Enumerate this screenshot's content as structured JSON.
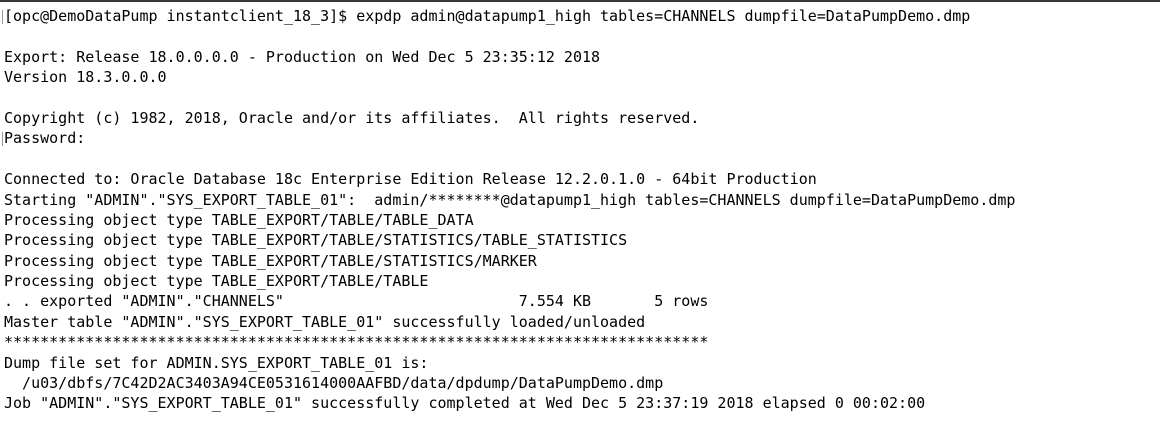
{
  "terminal": {
    "lines": [
      "[opc@DemoDataPump instantclient_18_3]$ expdp admin@datapump1_high tables=CHANNELS dumpfile=DataPumpDemo.dmp",
      "",
      "Export: Release 18.0.0.0.0 - Production on Wed Dec 5 23:35:12 2018",
      "Version 18.3.0.0.0",
      "",
      "Copyright (c) 1982, 2018, Oracle and/or its affiliates.  All rights reserved.",
      "Password:",
      "",
      "Connected to: Oracle Database 18c Enterprise Edition Release 12.2.0.1.0 - 64bit Production",
      "Starting \"ADMIN\".\"SYS_EXPORT_TABLE_01\":  admin/********@datapump1_high tables=CHANNELS dumpfile=DataPumpDemo.dmp",
      "Processing object type TABLE_EXPORT/TABLE/TABLE_DATA",
      "Processing object type TABLE_EXPORT/TABLE/STATISTICS/TABLE_STATISTICS",
      "Processing object type TABLE_EXPORT/TABLE/STATISTICS/MARKER",
      "Processing object type TABLE_EXPORT/TABLE/TABLE",
      ". . exported \"ADMIN\".\"CHANNELS\"                          7.554 KB       5 rows",
      "Master table \"ADMIN\".\"SYS_EXPORT_TABLE_01\" successfully loaded/unloaded",
      "******************************************************************************",
      "Dump file set for ADMIN.SYS_EXPORT_TABLE_01 is:",
      "  /u03/dbfs/7C42D2AC3403A94CE0531614000AAFBD/data/dpdump/DataPumpDemo.dmp",
      "Job \"ADMIN\".\"SYS_EXPORT_TABLE_01\" successfully completed at Wed Dec 5 23:37:19 2018 elapsed 0 00:02:00"
    ],
    "background_color": "#ffffff",
    "text_color": "#000000"
  }
}
